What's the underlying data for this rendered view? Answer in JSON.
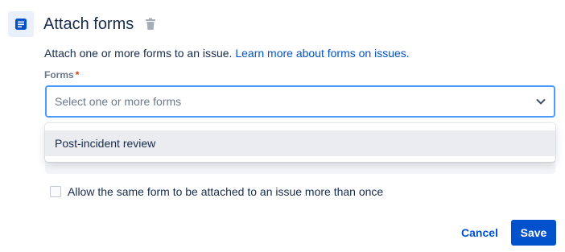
{
  "header": {
    "icon": "form-document-icon",
    "title": "Attach forms",
    "delete_icon": "trash-icon"
  },
  "description": {
    "text": "Attach one or more forms to an issue.",
    "link": "Learn more about forms on issues."
  },
  "forms_field": {
    "label": "Forms",
    "required_marker": "*",
    "placeholder": "Select one or more forms",
    "dropdown_icon": "chevron-down-icon",
    "options": [
      "Post-incident review"
    ]
  },
  "allow_duplicate": {
    "label": "Allow the same form to be attached to an issue more than once",
    "checked": false
  },
  "footer": {
    "cancel_label": "Cancel",
    "save_label": "Save"
  },
  "colors": {
    "accent": "#0052cc",
    "focus_border": "#4c9aff",
    "required": "#de350b",
    "text": "#172b4d"
  }
}
